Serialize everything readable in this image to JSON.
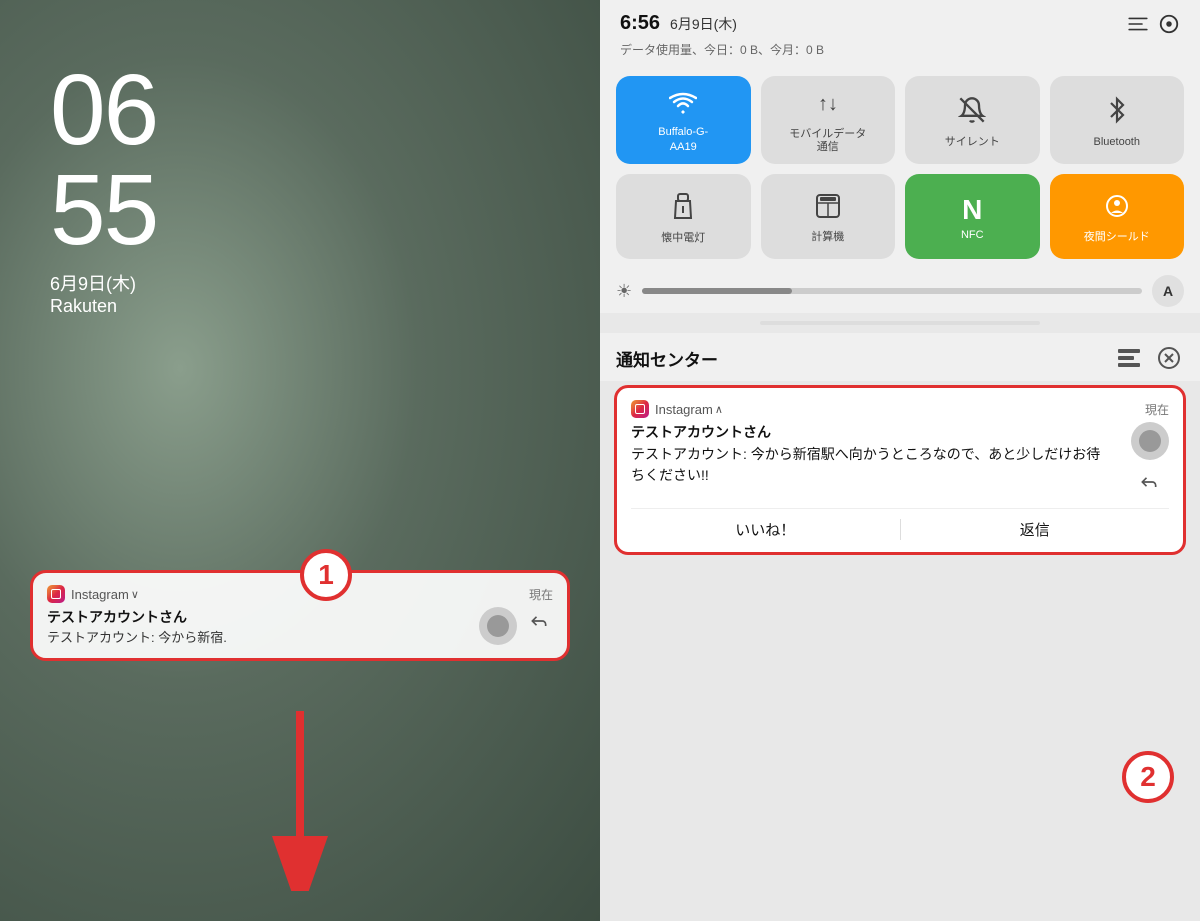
{
  "left": {
    "clock": {
      "hour": "06",
      "minute": "55"
    },
    "date": "6月9日(木)",
    "carrier": "Rakuten",
    "notification1": {
      "app": "Instagram",
      "chevron": "∨",
      "time": "現在",
      "sender": "テストアカウントさん",
      "message": "テストアカウント: 今から新宿.",
      "badge": "1"
    },
    "arrow_label": "下矢印"
  },
  "right": {
    "status": {
      "time": "6:56",
      "date": "6月9日(木)",
      "data_usage": "データ使用量、今日：0 B、今月：0 B"
    },
    "tiles_row1": [
      {
        "id": "wifi",
        "icon": "📶",
        "label": "Buffalo-G-\nAA19",
        "active": "blue",
        "icon_unicode": "wifi"
      },
      {
        "id": "mobile-data",
        "icon": "↑↓",
        "label": "モバイルデータ通信",
        "active": false
      },
      {
        "id": "silent",
        "icon": "🔕",
        "label": "サイレント",
        "active": false
      },
      {
        "id": "bluetooth",
        "icon": "✦",
        "label": "Bluetooth",
        "active": false
      }
    ],
    "tiles_row2": [
      {
        "id": "flashlight",
        "icon": "🔦",
        "label": "懐中電灯",
        "active": false
      },
      {
        "id": "calculator",
        "icon": "⊞",
        "label": "計算機",
        "active": false
      },
      {
        "id": "nfc",
        "icon": "N",
        "label": "NFC",
        "active": "green"
      },
      {
        "id": "night-shield",
        "icon": "👁",
        "label": "夜間シールド",
        "active": "orange"
      }
    ],
    "brightness": {
      "icon": "☀",
      "font_label": "A"
    },
    "notification_center": {
      "title": "通知センター",
      "icons": [
        "list",
        "close"
      ]
    },
    "notification2": {
      "app": "Instagram",
      "chevron": "∧",
      "time": "現在",
      "sender": "テストアカウントさん",
      "message": "テストアカウント: 今から新宿駅へ向かうところなので、あと少しだけお待ちください!!",
      "action_like": "いいね！",
      "action_reply": "返信",
      "badge": "2"
    }
  }
}
